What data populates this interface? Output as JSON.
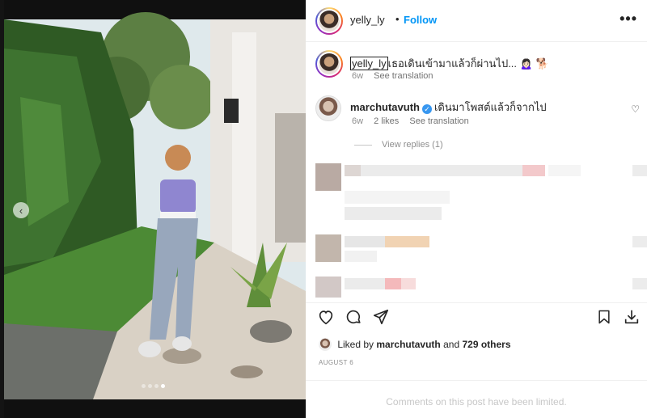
{
  "header": {
    "username": "yelly_ly",
    "separator": "•",
    "follow_label": "Follow",
    "more_label": "•••"
  },
  "caption": {
    "username": "yelly_ly",
    "text": "เธอเดินเข้ามาแล้วก็ผ่านไป... 🙍🏻‍♀️ 🐕",
    "age": "6w",
    "see_translation": "See translation"
  },
  "comment": {
    "username": "marchutavuth",
    "verified": true,
    "text": "เดินมาโพสต์แล้วก็จากไป",
    "age": "6w",
    "likes": "2 likes",
    "see_translation": "See translation",
    "view_replies": "View replies (1)"
  },
  "likes": {
    "prefix": "Liked by",
    "user": "marchutavuth",
    "conjunction": "and",
    "others": "729 others"
  },
  "post_date": "AUGUST 6",
  "comments_limited": "Comments on this post have been limited.",
  "carousel": {
    "slide_count": 4,
    "active_index": 3
  },
  "colors": {
    "follow": "#0095f6",
    "secondary_text": "#8e8e8e",
    "verified": "#3897f0"
  }
}
